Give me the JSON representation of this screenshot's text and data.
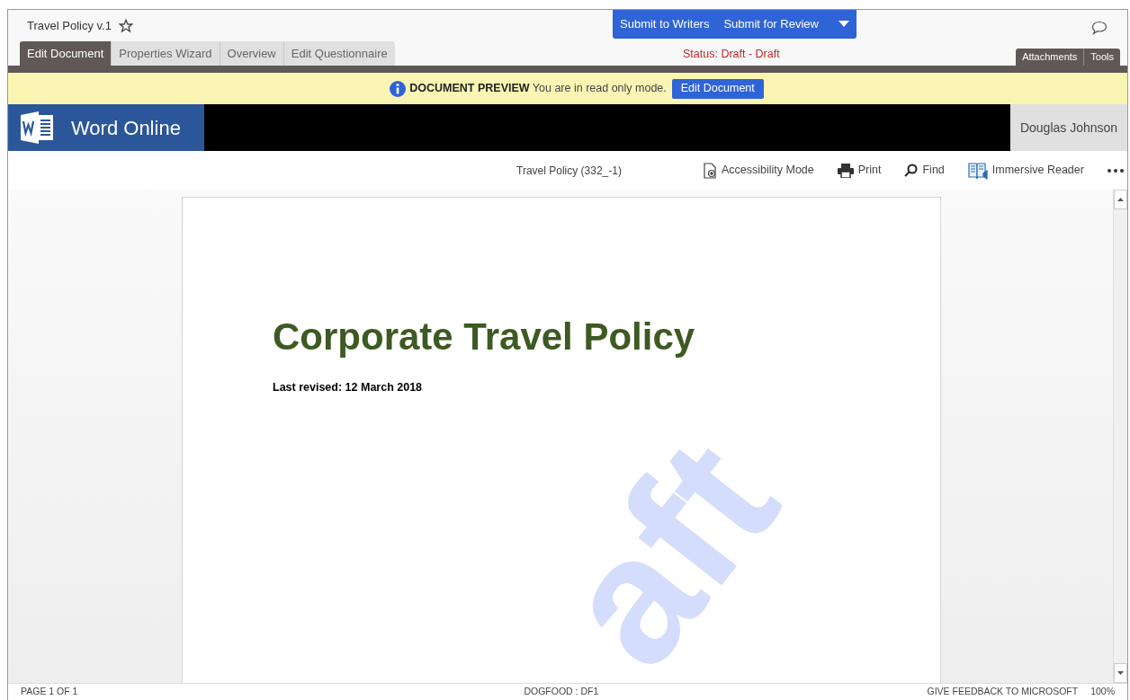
{
  "header": {
    "title": "Travel Policy v.1",
    "starred": false,
    "actions": [
      "Submit to Writers",
      "Submit for Review"
    ]
  },
  "tabs": [
    {
      "label": "Edit Document",
      "selected": true
    },
    {
      "label": "Properties Wizard",
      "selected": false
    },
    {
      "label": "Overview",
      "selected": false
    },
    {
      "label": "Edit Questionnaire",
      "selected": false
    }
  ],
  "status": "Status: Draft - Draft",
  "side_tabs": [
    "Attachments",
    "Tools"
  ],
  "banner": {
    "heading": "DOCUMENT PREVIEW",
    "message": "You are in read only mode.",
    "button": "Edit Document"
  },
  "app_bar": {
    "title": "Word Online",
    "user": "Douglas Johnson"
  },
  "toolbar": {
    "document_name": "Travel Policy (332_-1)",
    "items": [
      {
        "kind": "accessibility",
        "label": "Accessibility Mode"
      },
      {
        "kind": "print",
        "label": "Print"
      },
      {
        "kind": "find",
        "label": "Find"
      },
      {
        "kind": "reader",
        "label": "Immersive Reader"
      }
    ]
  },
  "document": {
    "title": "Corporate Travel Policy",
    "revised": "Last revised: 12 March 2018",
    "watermark": "aft"
  },
  "status_bar": {
    "page": "PAGE 1 OF 1",
    "environment": "DOGFOOD : DF1",
    "feedback": "GIVE FEEDBACK TO MICROSOFT",
    "zoom": "100%"
  }
}
